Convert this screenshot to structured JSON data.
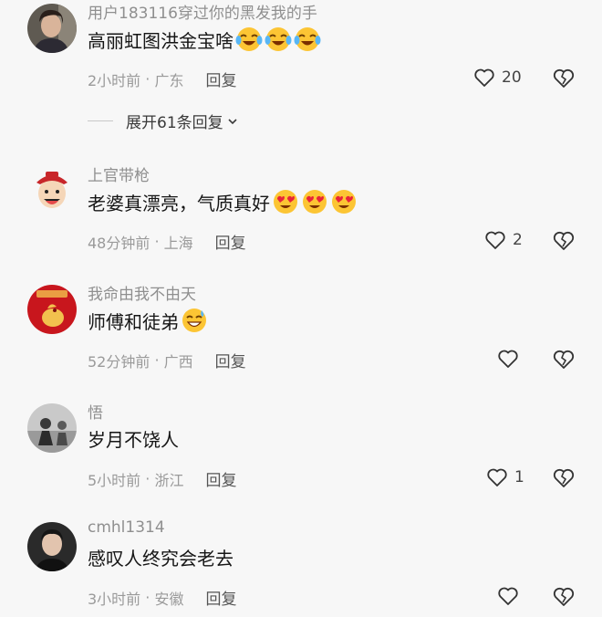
{
  "comments": [
    {
      "username": "用户183116穿过你的黑发我的手",
      "text": "高丽虹图洪金宝啥",
      "emojis": [
        "laugh-cry-icon",
        "laugh-cry-icon",
        "laugh-cry-icon"
      ],
      "time": "2小时前",
      "location": "广东",
      "reply_label": "回复",
      "like_count": "20",
      "expand_label": "展开61条回复"
    },
    {
      "username": "上官带枪",
      "text": "老婆真漂亮，气质真好",
      "emojis": [
        "heart-eyes-icon",
        "heart-eyes-icon",
        "heart-eyes-icon"
      ],
      "time": "48分钟前",
      "location": "上海",
      "reply_label": "回复",
      "like_count": "2"
    },
    {
      "username": "我命由我不由天",
      "text": "师傅和徒弟",
      "emojis": [
        "grin-sweat-icon"
      ],
      "time": "52分钟前",
      "location": "广西",
      "reply_label": "回复",
      "like_count": ""
    },
    {
      "username": "悟",
      "text": "岁月不饶人",
      "emojis": [],
      "time": "5小时前",
      "location": "浙江",
      "reply_label": "回复",
      "like_count": "1"
    },
    {
      "username": "cmhl1314",
      "text": "感叹人终究会老去",
      "emojis": [],
      "time": "3小时前",
      "location": "安徽",
      "reply_label": "回复",
      "like_count": ""
    }
  ],
  "colors": {
    "background": "#f7f7f7",
    "username": "#8f8f8f",
    "text": "#161616",
    "meta": "#9a9a9a"
  }
}
